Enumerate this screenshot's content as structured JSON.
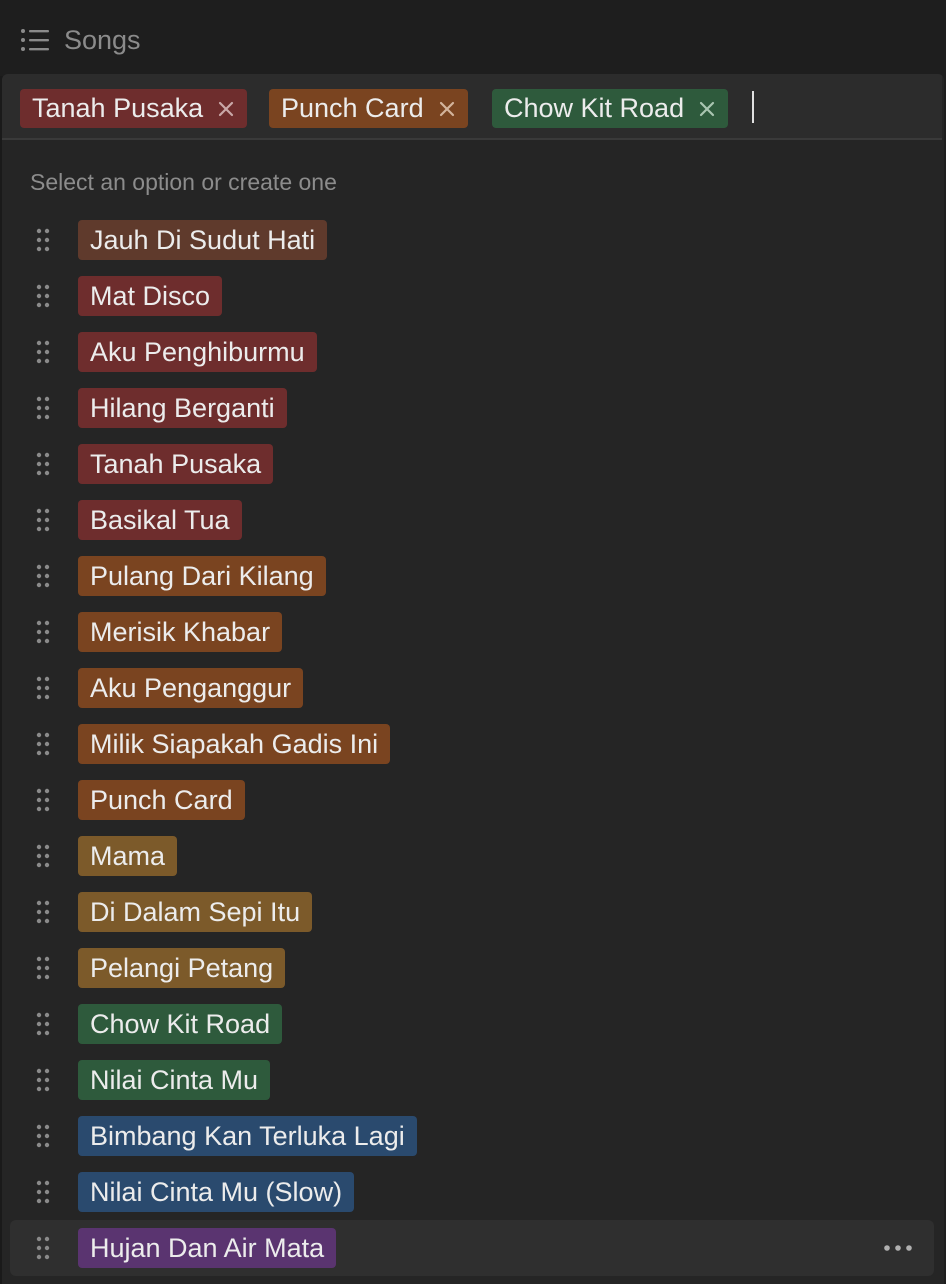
{
  "header": {
    "title": "Songs",
    "icon": "list-icon"
  },
  "selected_tags": [
    {
      "label": "Tanah Pusaka",
      "color": "#6e2d2d"
    },
    {
      "label": "Punch Card",
      "color": "#7a4420"
    },
    {
      "label": "Chow Kit Road",
      "color": "#2e5a3c"
    }
  ],
  "hint": "Select an option or create one",
  "options": [
    {
      "label": "Jauh Di Sudut Hati",
      "color": "#5f3a2c"
    },
    {
      "label": "Mat Disco",
      "color": "#6e2d2d"
    },
    {
      "label": "Aku Penghiburmu",
      "color": "#6e2d2d"
    },
    {
      "label": "Hilang Berganti",
      "color": "#6e2d2d"
    },
    {
      "label": "Tanah Pusaka",
      "color": "#6e2d2d"
    },
    {
      "label": "Basikal Tua",
      "color": "#6e2d2d"
    },
    {
      "label": "Pulang Dari Kilang",
      "color": "#7a4420"
    },
    {
      "label": "Merisik Khabar",
      "color": "#7a4420"
    },
    {
      "label": "Aku Penganggur",
      "color": "#7a4420"
    },
    {
      "label": "Milik Siapakah Gadis Ini",
      "color": "#7a4420"
    },
    {
      "label": "Punch Card",
      "color": "#7a4420"
    },
    {
      "label": "Mama",
      "color": "#7c5a2a"
    },
    {
      "label": "Di Dalam Sepi Itu",
      "color": "#7c5a2a"
    },
    {
      "label": "Pelangi Petang",
      "color": "#7c5a2a"
    },
    {
      "label": "Chow Kit Road",
      "color": "#2e5a3c"
    },
    {
      "label": "Nilai Cinta Mu",
      "color": "#2e5a3c"
    },
    {
      "label": "Bimbang Kan Terluka Lagi",
      "color": "#2a4a6e"
    },
    {
      "label": "Nilai Cinta Mu (Slow)",
      "color": "#2a4a6e"
    },
    {
      "label": "Hujan Dan Air Mata",
      "color": "#5a3470",
      "hovered": true
    }
  ]
}
